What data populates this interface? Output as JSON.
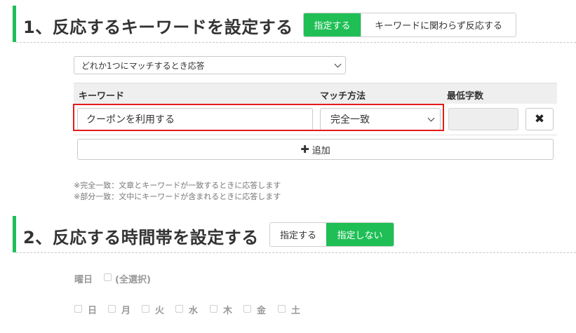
{
  "section1": {
    "title": "1、反応するキーワードを設定する",
    "toggle": [
      {
        "label": "指定する",
        "active": true
      },
      {
        "label": "キーワードに関わらず反応する",
        "active": false
      }
    ]
  },
  "condition_select": {
    "value": "どれか1つにマッチするとき応答"
  },
  "table": {
    "headers": [
      "キーワード",
      "マッチ方法",
      "最低字数"
    ],
    "rows": [
      {
        "keyword": "クーポンを利用する",
        "match_method": "完全一致",
        "min_chars": "",
        "delete_icon": "times-icon"
      }
    ]
  },
  "add_button": {
    "label": "追加",
    "icon": "plus-icon"
  },
  "notes": [
    "※完全一致：文章とキーワードが一致するときに応答します",
    "※部分一致：文中にキーワードが含まれるときに応答します"
  ],
  "section2": {
    "title": "2、反応する時間帯を設定する",
    "toggle": [
      {
        "label": "指定する",
        "active": false
      },
      {
        "label": "指定しない",
        "active": true
      }
    ]
  },
  "weekday": {
    "label": "曜日",
    "select_all_label": "(全選択)",
    "days": [
      "日",
      "月",
      "火",
      "水",
      "木",
      "金",
      "土"
    ]
  },
  "colors": {
    "accent": "#1fbf56",
    "highlight": "#e41b1b"
  }
}
